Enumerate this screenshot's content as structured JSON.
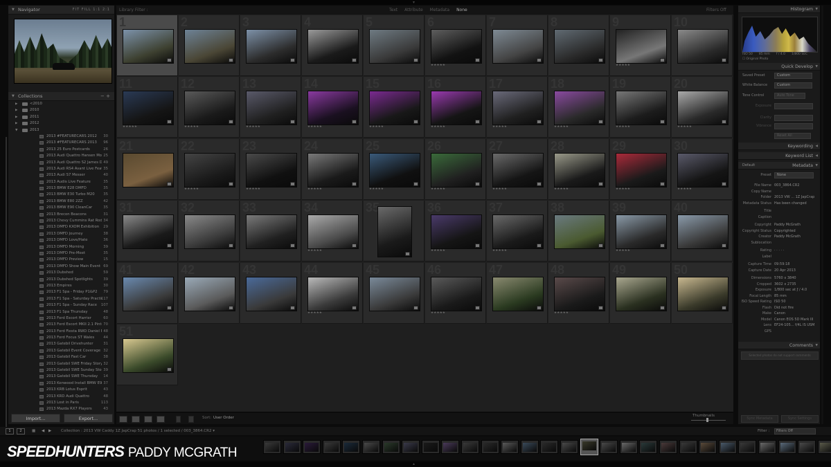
{
  "app": {
    "name": "Lightroom Library"
  },
  "navigator": {
    "title": "Navigator",
    "controls": "FIT  FILL  1:1  2:1"
  },
  "collections": {
    "title": "Collections",
    "controls": "−  +",
    "top_items": [
      {
        "label": "<2010",
        "arrow": "▶"
      },
      {
        "label": "2010",
        "arrow": "▶"
      },
      {
        "label": "2011",
        "arrow": "▶"
      },
      {
        "label": "2012",
        "arrow": "▶"
      },
      {
        "label": "2013",
        "arrow": "▼"
      }
    ],
    "items": [
      {
        "label": "2013 #FEATURECARS 2012",
        "count": "30"
      },
      {
        "label": "2013 #FEATURECARS 2013",
        "count": "96"
      },
      {
        "label": "2013 25 Euro Postcards",
        "count": "26"
      },
      {
        "label": "2013 Audi Quattro Hansen Mot...",
        "count": "25"
      },
      {
        "label": "2013 Audi Quattro S2 James Davey",
        "count": "49"
      },
      {
        "label": "2013 Audi RS4 Avant Live Feature",
        "count": "35"
      },
      {
        "label": "2013 Audi S7 Messer",
        "count": "40"
      },
      {
        "label": "2013 Audis Live Feature",
        "count": "35"
      },
      {
        "label": "2013 BMW E28 DMFD",
        "count": "35"
      },
      {
        "label": "2013 BMW E30 Turbo M20",
        "count": "35"
      },
      {
        "label": "2013 BMW E80 2ZZ",
        "count": "42"
      },
      {
        "label": "2013 BMW E90 CleanCar",
        "count": "35"
      },
      {
        "label": "2013 Brecon Beacons",
        "count": "31"
      },
      {
        "label": "2013 Chevy Cummins Rat Rod",
        "count": "34"
      },
      {
        "label": "2013 DMFD KXOM Exhibition",
        "count": "29"
      },
      {
        "label": "2013 DMFD Journey",
        "count": "38"
      },
      {
        "label": "2013 DMFD Love/Hate",
        "count": "36"
      },
      {
        "label": "2013 DMFD Morning",
        "count": "39"
      },
      {
        "label": "2013 DMFD Pre-Meet",
        "count": "35"
      },
      {
        "label": "2013 DMFD Preview",
        "count": "15"
      },
      {
        "label": "2013 DMFD Show Main Event",
        "count": "69"
      },
      {
        "label": "2013 Dubshed",
        "count": "59"
      },
      {
        "label": "2013 Dubshed Spotlights",
        "count": "39"
      },
      {
        "label": "2013 Empires",
        "count": "30"
      },
      {
        "label": "2013 F1 Spa - Friday P1&P2",
        "count": "79"
      },
      {
        "label": "2013 F1 Spa - Saturday Practice ...",
        "count": "117"
      },
      {
        "label": "2013 F1 Spa - Sunday Race",
        "count": "107"
      },
      {
        "label": "2013 F1 Spa Thursday",
        "count": "48"
      },
      {
        "label": "2013 Ford Escort Harrier",
        "count": "60"
      },
      {
        "label": "2013 Ford Escort MKII 2.1 Pinto",
        "count": "70"
      },
      {
        "label": "2013 Ford Fiesta RWD Daniel Bjork",
        "count": "48"
      },
      {
        "label": "2013 Ford Focus ST Wales",
        "count": "44"
      },
      {
        "label": "2013 Gatebil Drivehunter",
        "count": "31"
      },
      {
        "label": "2013 Gatebil Event Coverage",
        "count": "32"
      },
      {
        "label": "2013 Gatebil Fast Car",
        "count": "38"
      },
      {
        "label": "2013 Gatebil SWE Friday Story",
        "count": "32"
      },
      {
        "label": "2013 Gatebil SWE Sunday Story",
        "count": "39"
      },
      {
        "label": "2013 Gatebil SWE Thursday",
        "count": "14"
      },
      {
        "label": "2013 Kenwood Install BMW E90",
        "count": "37"
      },
      {
        "label": "2013 KRB Lotus Esprit",
        "count": "43"
      },
      {
        "label": "2013 KRD Audi Quattro",
        "count": "48"
      },
      {
        "label": "2013 Lost in Paris",
        "count": "113"
      },
      {
        "label": "2013 Mazda RX7 Players",
        "count": "43"
      }
    ]
  },
  "left_buttons": {
    "import": "Import...",
    "export": "Export..."
  },
  "library_filter": {
    "title": "Library Filter :",
    "options": [
      "Text",
      "Attribute",
      "Metadata",
      "None"
    ],
    "active": "None",
    "right": "Filters Off"
  },
  "grid": {
    "cells": [
      {
        "n": "1",
        "stars": "",
        "sel": true,
        "c1": "#7c92aa",
        "c2": "#3d4030"
      },
      {
        "n": "2",
        "stars": "",
        "c1": "#6d8296",
        "c2": "#4a4635"
      },
      {
        "n": "3",
        "stars": "",
        "c1": "#7d91a8",
        "c2": "#2c2c2c"
      },
      {
        "n": "4",
        "stars": "",
        "c1": "#9a9a9a",
        "c2": "#1a1a1a"
      },
      {
        "n": "5",
        "stars": "",
        "c1": "#6e7a82",
        "c2": "#3a3a3a"
      },
      {
        "n": "6",
        "stars": "★★★★★",
        "c1": "#5e5e5e",
        "c2": "#121212"
      },
      {
        "n": "7",
        "stars": "",
        "c1": "#7e8a94",
        "c2": "#444"
      },
      {
        "n": "8",
        "stars": "",
        "c1": "#606a72",
        "c2": "#2a2a2a"
      },
      {
        "n": "9",
        "stars": "★★★★★",
        "c1": "#222",
        "c2": "#777"
      },
      {
        "n": "10",
        "stars": "",
        "c1": "#8a8a8a",
        "c2": "#2a2a2a"
      },
      {
        "n": "11",
        "stars": "★★★★★",
        "c1": "#2a3a55",
        "c2": "#151515"
      },
      {
        "n": "12",
        "stars": "★★★★★",
        "c1": "#5a5a5a",
        "c2": "#1a1a1a"
      },
      {
        "n": "13",
        "stars": "★★★★★",
        "c1": "#5a5a6a",
        "c2": "#202020"
      },
      {
        "n": "14",
        "stars": "★★★★★",
        "c1": "#8a3aa0",
        "c2": "#1a1020"
      },
      {
        "n": "15",
        "stars": "★★★★★",
        "c1": "#7a2a90",
        "c2": "#181818"
      },
      {
        "n": "16",
        "stars": "★★★★★",
        "c1": "#9a3ab0",
        "c2": "#151515"
      },
      {
        "n": "17",
        "stars": "★★★★★",
        "c1": "#6a6a7a",
        "c2": "#202020"
      },
      {
        "n": "18",
        "stars": "★★★★★",
        "c1": "#8a4aa0",
        "c2": "#2a2a2a"
      },
      {
        "n": "19",
        "stars": "★★★★★",
        "c1": "#777",
        "c2": "#1c1c1c"
      },
      {
        "n": "20",
        "stars": "★★★★★",
        "c1": "#aaa",
        "c2": "#2a2a2a"
      },
      {
        "n": "21",
        "stars": "",
        "c1": "#5a4a30",
        "c2": "#7a6040"
      },
      {
        "n": "22",
        "stars": "★★★★★",
        "c1": "#444",
        "c2": "#1a1a1a"
      },
      {
        "n": "23",
        "stars": "★★★★★",
        "c1": "#4a4a4a",
        "c2": "#101010"
      },
      {
        "n": "24",
        "stars": "★★★★★",
        "c1": "#7a7a7a",
        "c2": "#1a1a1a"
      },
      {
        "n": "25",
        "stars": "★★★★★",
        "c1": "#3a5a7a",
        "c2": "#101010"
      },
      {
        "n": "26",
        "stars": "★★★★★",
        "c1": "#3a6a3a",
        "c2": "#202020"
      },
      {
        "n": "27",
        "stars": "★★★★★",
        "c1": "#6a6a6a",
        "c2": "#151515"
      },
      {
        "n": "28",
        "stars": "★★★★★",
        "c1": "#9a9a8a",
        "c2": "#1a1a1a"
      },
      {
        "n": "29",
        "stars": "★★★★★",
        "c1": "#aa2a3a",
        "c2": "#1a1a1a"
      },
      {
        "n": "30",
        "stars": "★★★★★",
        "c1": "#5a5a6a",
        "c2": "#151515"
      },
      {
        "n": "31",
        "stars": "",
        "c1": "#8a8a8a",
        "c2": "#1a1a1a"
      },
      {
        "n": "32",
        "stars": "",
        "c1": "#8a8a8a",
        "c2": "#3a3a3a"
      },
      {
        "n": "33",
        "stars": "",
        "c1": "#7a7a7a",
        "c2": "#202020"
      },
      {
        "n": "34",
        "stars": "★★★★★",
        "c1": "#aaa",
        "c2": "#4a4a4a"
      },
      {
        "n": "35",
        "stars": "",
        "c1": "#6a6a6a",
        "c2": "#1a1a1a",
        "portrait": true
      },
      {
        "n": "36",
        "stars": "★★★★★",
        "c1": "#4a3a6a",
        "c2": "#151515"
      },
      {
        "n": "37",
        "stars": "★★★★★",
        "c1": "#6a6a6a",
        "c2": "#1a1a1a"
      },
      {
        "n": "38",
        "stars": "",
        "c1": "#6a7a80",
        "c2": "#4a5a30"
      },
      {
        "n": "39",
        "stars": "★★★★★",
        "c1": "#8a9aa8",
        "c2": "#2a2a2a"
      },
      {
        "n": "40",
        "stars": "",
        "c1": "#8a9aaa",
        "c2": "#3a3a3a"
      },
      {
        "n": "41",
        "stars": "",
        "c1": "#6a8ab0",
        "c2": "#3a3a3a"
      },
      {
        "n": "42",
        "stars": "",
        "c1": "#9aaab8",
        "c2": "#5a5a5a"
      },
      {
        "n": "43",
        "stars": "",
        "c1": "#4a6a9a",
        "c2": "#3a3a3a"
      },
      {
        "n": "44",
        "stars": "★★★★★",
        "c1": "#bababa",
        "c2": "#3a3a3a"
      },
      {
        "n": "45",
        "stars": "",
        "c1": "#7a8a9a",
        "c2": "#3a3a3a"
      },
      {
        "n": "46",
        "stars": "★★★★★",
        "c1": "#5a5a5a",
        "c2": "#1a1a1a"
      },
      {
        "n": "47",
        "stars": "",
        "c1": "#8a8a70",
        "c2": "#2a3a20"
      },
      {
        "n": "48",
        "stars": "★★★★★",
        "c1": "#5a4a4a",
        "c2": "#1a1a1a"
      },
      {
        "n": "49",
        "stars": "",
        "c1": "#aaa890",
        "c2": "#2a3020"
      },
      {
        "n": "50",
        "stars": "",
        "c1": "#c8b890",
        "c2": "#3a3a2a"
      },
      {
        "n": "51",
        "stars": "",
        "c1": "#d8c890",
        "c2": "#3a4a2a"
      }
    ]
  },
  "toolbar": {
    "sort_label": "Sort:",
    "sort_value": "User Order",
    "thumbnails_label": "Thumbnails"
  },
  "right_panel": {
    "histogram": {
      "title": "Histogram",
      "iso": "ISO 50",
      "focal": "85 mm",
      "aperture": "f / 4.0",
      "shutter": "1/800 SEC",
      "original": "Original Photo"
    },
    "quick_develop": {
      "title": "Quick Develop",
      "saved_preset_label": "Saved Preset",
      "saved_preset_value": "Custom",
      "white_balance_label": "White Balance",
      "white_balance_value": "Custom",
      "tone_control_label": "Tone Control",
      "auto_tone": "Auto Tone",
      "rows": [
        "Exposure",
        "Clarity",
        "Vibrance"
      ],
      "reset": "Reset All"
    },
    "keywording": {
      "title": "Keywording"
    },
    "keyword_list": {
      "title": "Keyword List"
    },
    "metadata": {
      "title": "Metadata",
      "default_label": "Default",
      "preset_label": "Preset",
      "preset_value": "None",
      "fields": [
        {
          "label": "File Name",
          "value": "003_3864.CR2"
        },
        {
          "label": "Copy Name",
          "value": ""
        },
        {
          "label": "Folder",
          "value": "2013 VW ... 1Z JapCrap"
        },
        {
          "label": "Metadata Status",
          "value": "Has been changed"
        },
        {
          "label": "Title",
          "value": ""
        },
        {
          "label": "Caption",
          "value": ""
        },
        {
          "label": "Copyright",
          "value": "Paddy McGrath"
        },
        {
          "label": "Copyright Status",
          "value": "Copyrighted"
        },
        {
          "label": "Creator",
          "value": "Paddy McGrath"
        },
        {
          "label": "Sublocation",
          "value": ""
        },
        {
          "label": "Rating",
          "value": "· · · · ·"
        },
        {
          "label": "Label",
          "value": ""
        },
        {
          "label": "Capture Time",
          "value": "09:59:18"
        },
        {
          "label": "Capture Date",
          "value": "20 Apr 2013"
        },
        {
          "label": "Dimensions",
          "value": "5760 x 3840"
        },
        {
          "label": "Cropped",
          "value": "3602 x 2735"
        },
        {
          "label": "Exposure",
          "value": "1/800 sec at ƒ / 4.0"
        },
        {
          "label": "Focal Length",
          "value": "85 mm"
        },
        {
          "label": "ISO Speed Rating",
          "value": "ISO 50"
        },
        {
          "label": "Flash",
          "value": "Did not fire"
        },
        {
          "label": "Make",
          "value": "Canon"
        },
        {
          "label": "Model",
          "value": "Canon EOS 5D Mark III"
        },
        {
          "label": "Lens",
          "value": "EF24-105... f/4L IS USM"
        },
        {
          "label": "GPS",
          "value": ""
        }
      ]
    },
    "comments": {
      "title": "Comments",
      "sync_text": "Selected photos do not support comments"
    },
    "buttons": {
      "sync_metadata": "Sync Metadata",
      "sync_settings": "Sync Settings"
    }
  },
  "filmstrip": {
    "page1": "1",
    "page2": "2",
    "breadcrumb": "Collection : 2013 VW Caddy 1Z JapCrap    51 photos / 1 selected / 003_3864.CR2 ▾",
    "filter_label": "Filter :",
    "filter_value": "Filters Off",
    "thumbs": [
      "#3a3a3a",
      "#2a2a3a",
      "#2a1a3a",
      "#3a3a3a",
      "#1a2a3a",
      "#4a4a4a",
      "#2a3a2a",
      "#3a3a4a",
      "#1a1a1a",
      "#4a3a5a",
      "#3a3a3a",
      "#2a2a2a",
      "#5a5a5a",
      "#3a4a5a",
      "#2a2a2a",
      "#4a4a4a",
      "#3a3a2a",
      "#4a4a4a",
      "#6a6a6a",
      "#2a3a3a",
      "#4a3a3a",
      "#3a3a3a",
      "#5a4a3a",
      "#4a5a6a",
      "#3a3a3a",
      "#6a6a6a",
      "#5a6a7a",
      "#4a4a4a",
      "#5a5a4a",
      "#6a6a5a"
    ]
  },
  "watermark": {
    "brand": "SPEEDHUNTERS",
    "person": "PADDY MCGRATH"
  }
}
